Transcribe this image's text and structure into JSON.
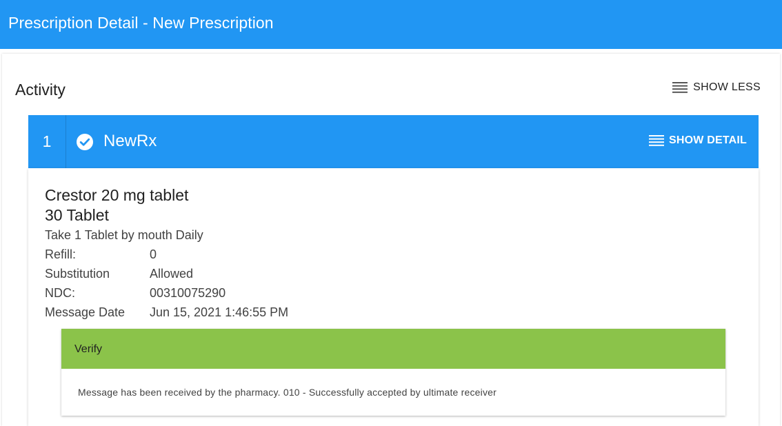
{
  "appbar": {
    "title": "Prescription Detail - New Prescription",
    "color": "#2196f3"
  },
  "activity": {
    "title": "Activity",
    "toggle_label": "SHOW LESS",
    "toggle_icon": "menu-icon"
  },
  "steps": [
    {
      "number": "1",
      "status_icon": "check-circle-icon",
      "title": "NewRx",
      "detail_label": "SHOW DETAIL",
      "detail_icon": "menu-icon",
      "drug": "Crestor 20 mg tablet",
      "quantity": "30 Tablet",
      "sig": "Take 1 Tablet by mouth Daily",
      "details": [
        {
          "label": "Refill:",
          "value": "0"
        },
        {
          "label": "Substitution",
          "value": "Allowed"
        },
        {
          "label": "NDC:",
          "value": "00310075290"
        },
        {
          "label": "Message Date",
          "value": "Jun 15, 2021 1:46:55 PM"
        }
      ],
      "verify": {
        "title": "Verify",
        "message": "Message has been received by the pharmacy. 010 - Successfully accepted by ultimate receiver",
        "color": "#8bc34a"
      }
    }
  ]
}
